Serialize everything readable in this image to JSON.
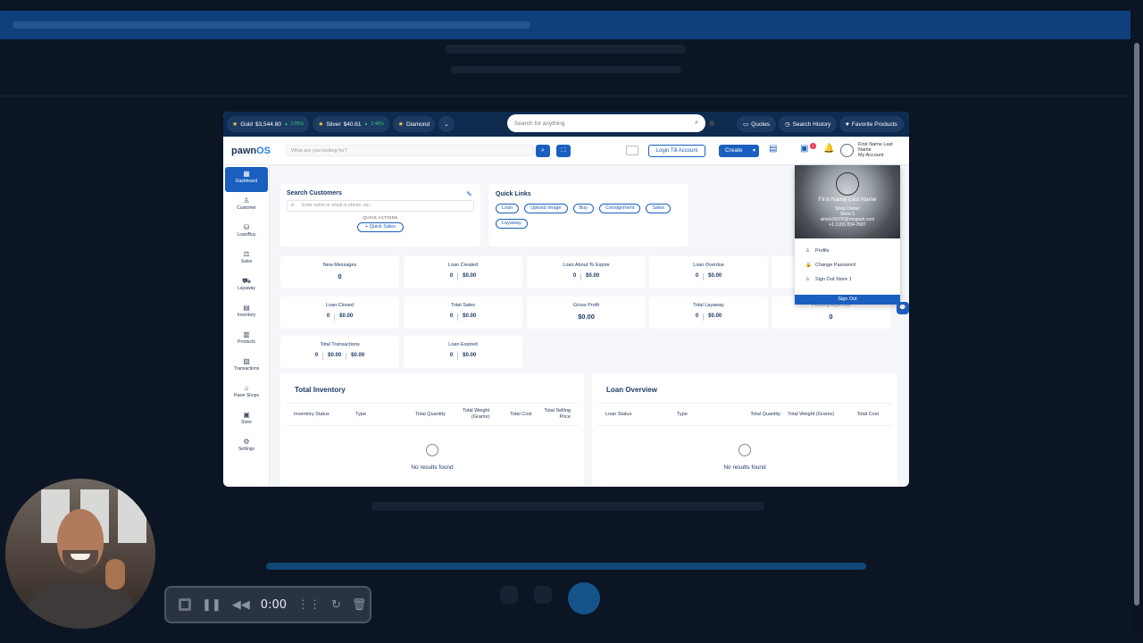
{
  "metals": [
    {
      "name": "Gold",
      "price": "$3,544.80",
      "change": "0.85%"
    },
    {
      "name": "Silver",
      "price": "$40.61",
      "change": "2.48%"
    },
    {
      "name": "Diamond"
    }
  ],
  "top_search": {
    "placeholder": "Search for anything"
  },
  "top_buttons": {
    "quotes": "Quotes",
    "history": "Search History",
    "favorites": "Favorite Products"
  },
  "logo": {
    "main": "pawn",
    "accent": "OS"
  },
  "header": {
    "search_placeholder": "What are you looking for?",
    "till_button": "Login Till Account",
    "create_button": "Create",
    "notification_count": "2",
    "user_name": "First Name Last Name",
    "account_label": "My Account"
  },
  "sidebar": [
    {
      "label": "Dashboard",
      "active": true
    },
    {
      "label": "Customer"
    },
    {
      "label": "Loan/Buy"
    },
    {
      "label": "Sales"
    },
    {
      "label": "Layaway"
    },
    {
      "label": "Inventory"
    },
    {
      "label": "Products"
    },
    {
      "label": "Transactions"
    },
    {
      "label": "Pawn Shops"
    },
    {
      "label": "Store"
    },
    {
      "label": "Settings"
    }
  ],
  "search_customers": {
    "title": "Search Customers",
    "placeholder": "Enter name or email or phone, etc.",
    "quick_actions_label": "QUICK ACTIONS",
    "quick_sales": "+ Quick Sales"
  },
  "quick_links": {
    "title": "Quick Links",
    "items": [
      "Loan",
      "Upload Image",
      "Buy",
      "Consignment",
      "Sales",
      "Layaway"
    ]
  },
  "stats": [
    {
      "label": "New Messages",
      "values": [
        "0"
      ]
    },
    {
      "label": "Loan Created",
      "values": [
        "0",
        "$0.00"
      ]
    },
    {
      "label": "Loan About To Expire",
      "values": [
        "0",
        "$0.00"
      ]
    },
    {
      "label": "Loan Overdue",
      "values": [
        "0",
        "$0.00"
      ]
    },
    {
      "label": "Loan Closed",
      "values": [
        "0",
        "$0.00"
      ]
    },
    {
      "label": "Total Sales",
      "values": [
        "0",
        "$0.00"
      ]
    },
    {
      "label": "Gross Profit",
      "values": [
        "$0.00"
      ]
    },
    {
      "label": "Total Layaway",
      "values": [
        "0",
        "$0.00"
      ]
    },
    {
      "label": "Pending Approval",
      "values": [
        "0"
      ]
    },
    {
      "label": "Total Transactions",
      "values": [
        "0",
        "$0.00",
        "$0.00"
      ]
    },
    {
      "label": "Loan Expired",
      "values": [
        "0",
        "$0.00"
      ]
    }
  ],
  "total_inventory": {
    "title": "Total Inventory",
    "columns": [
      "Inventory Status",
      "Type",
      "Total Quantity",
      "Total Weight (Grams)",
      "Total Cost",
      "Total Selling Price"
    ],
    "empty": "No results found"
  },
  "loan_overview": {
    "title": "Loan Overview",
    "columns": [
      "Loan Status",
      "Type",
      "Total Quantity",
      "Total Weight (Grams)",
      "Total Cost"
    ],
    "empty": "No results found"
  },
  "account_menu": {
    "name": "First Name Last Name",
    "role": "Shop Owner",
    "store": "Store 1",
    "email": "ximek39105@mogash.com",
    "phone": "+1 (120) 824-7607",
    "items": [
      "Profile",
      "Change Password",
      "Sign Out Store 1"
    ],
    "sign_out": "Sign Out"
  },
  "recorder": {
    "time": "0:00"
  }
}
